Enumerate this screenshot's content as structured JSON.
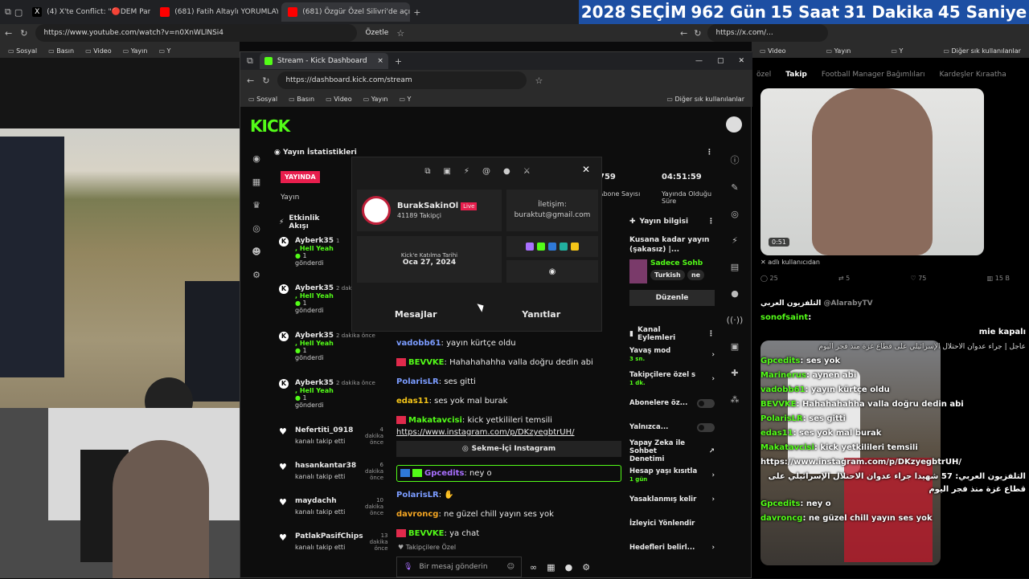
{
  "browser_left": {
    "tabs": [
      {
        "label": "(4) X'te Conflict: \"🔴DEM Partisi\""
      },
      {
        "label": "(681) Fatih Altaylı YORUMLAYAMIYOR"
      },
      {
        "label": "(681) Özgür Özel Silivri'de açıkla"
      }
    ],
    "url": "https://www.youtube.com/watch?v=n0XnWLlNSi4",
    "summarize_label": "Özetle",
    "bookmarks": [
      "Sosyal",
      "Basın",
      "Video",
      "Yayın",
      "Y"
    ]
  },
  "banner": {
    "year": "2028",
    "word": "SEÇİM",
    "days": "962 Gün",
    "hours": "15 Saat",
    "minutes": "31 Dakika",
    "seconds": "45 Saniye"
  },
  "browser_right": {
    "url": "https://x.com/...",
    "bookmarks": [
      "Video",
      "Yayın",
      "Y"
    ],
    "other_bookmarks": "Diğer sık kullanılanlar"
  },
  "kick": {
    "window_tab": "Stream - Kick Dashboard",
    "url": "https://dashboard.kick.com/stream",
    "bookmarks": [
      "Sosyal",
      "Basın",
      "Video",
      "Yayın",
      "Y"
    ],
    "other_bookmarks": "Diğer sık kullanılanlar",
    "logo": "KICK",
    "stats_title": "Yayın İstatistikleri",
    "live_badge": "YAYINDA",
    "live_label": "Yayın",
    "stat_subs_value": "759",
    "stat_subs_label": "Abone Sayısı",
    "stat_time_value": "04:51:59",
    "stat_time_label": "Yayında Olduğu Süre",
    "events_title": "Etkinlik Akışı",
    "events": [
      {
        "name": "Ayberk35",
        "time": "1",
        "message": "Hell Yeah",
        "count": "1",
        "action": "gönderdi"
      },
      {
        "name": "Ayberk35",
        "time": "2 dakika önce",
        "message": "Hell Yeah",
        "count": "1",
        "action": "gönderdi"
      },
      {
        "name": "Ayberk35",
        "time": "2 dakika önce",
        "message": "Hell Yeah",
        "count": "1",
        "action": "gönderdi"
      },
      {
        "name": "Ayberk35",
        "time": "2 dakika önce",
        "message": "Hell Yeah",
        "count": "1",
        "action": "gönderdi"
      }
    ],
    "follows": [
      {
        "name": "Nefertiti_0918",
        "time": "4 dakika önce",
        "action": "kanalı takip etti"
      },
      {
        "name": "hasankantar38",
        "time": "6 dakika önce",
        "action": "kanalı takip etti"
      },
      {
        "name": "maydachh",
        "time": "10 dakika önce",
        "action": "kanalı takip etti"
      },
      {
        "name": "PatlakPasifChips",
        "time": "13 dakika önce",
        "action": "kanalı takip etti"
      }
    ],
    "chat": [
      {
        "user": "vadobb61",
        "text": ": yayın kürtçe oldu",
        "color": "#7b9cff"
      },
      {
        "user": "BEVVKE",
        "text": ": Hahahahahha valla doğru dedin abi",
        "color": "#53fc18"
      },
      {
        "user": "PolarisLR",
        "text": ": ses gitti",
        "color": "#7b9cff"
      },
      {
        "user": "edas11",
        "text": ": ses yok mal burak",
        "color": "#f5c518"
      },
      {
        "user": "Makatavcisi",
        "text": ": kick yetkilileri temsili",
        "color": "#53fc18"
      }
    ],
    "chat_link": "https://www.instagram.com/p/DKzyegbtrUH/",
    "chat_link_button": "Sekme-İçi Instagram",
    "chat_highlight": {
      "user": "Gpcedits",
      "text": ": ney o",
      "color": "#a970ff"
    },
    "chat2": [
      {
        "user": "PolarisLR",
        "text": ":",
        "color": "#7b9cff"
      },
      {
        "user": "davroncg",
        "text": ": ne güzel chill yayın ses yok",
        "color": "#f5a623"
      },
      {
        "user": "BEVVKE",
        "text": ": ya chat",
        "color": "#53fc18"
      }
    ],
    "sub_only": "Takipçilere Özel",
    "chat_placeholder": "Bir mesaj gönderin",
    "stream_info_title": "Yayın bilgisi",
    "stream_title": "Kusana kadar yayın (şakasız) |...",
    "category": "Sadece Sohb",
    "tags": [
      "Turkish",
      "ne"
    ],
    "edit_button": "Düzenle",
    "mod_title": "Kanal Eylemleri",
    "mod_actions": [
      {
        "label": "Yavaş mod",
        "sub": "3 sn.",
        "kind": "chevron"
      },
      {
        "label": "Takipçilere özel s",
        "sub": "1 dk.",
        "kind": "chevron"
      },
      {
        "label": "Abonelere öz...",
        "sub": "",
        "kind": "toggle"
      },
      {
        "label": "Yalnızca...",
        "sub": "",
        "kind": "toggle"
      },
      {
        "label": "Yapay Zeka ile Sohbet Denetimi",
        "sub": "",
        "kind": "external"
      },
      {
        "label": "Hesap yaşı kısıtla",
        "sub": "1 gün",
        "kind": "chevron"
      },
      {
        "label": "Yasaklanmış kelir",
        "sub": "",
        "kind": "chevron"
      },
      {
        "label": "İzleyici Yönlendir",
        "sub": "",
        "kind": "none"
      },
      {
        "label": "Hedefleri belirl...",
        "sub": "",
        "kind": "chevron"
      }
    ],
    "profile": {
      "name": "BurakSakinOl",
      "live": "Live",
      "followers": "41189 Takipçi",
      "contact_label": "İletişim:",
      "contact_email": "buraktut@gmail.com",
      "joined_label": "Kick'e Katılma Tarihi",
      "joined_date": "Oca 27, 2024",
      "tab_messages": "Mesajlar",
      "tab_replies": "Yanıtlar"
    }
  },
  "x": {
    "tabs": [
      "özel",
      "Takip",
      "Football Manager Bağımlıları",
      "Kardeşler Kıraatha"
    ],
    "duration": "0:51",
    "username_caption": "adlı kullanıcıdan",
    "stats": [
      "25",
      "5",
      "75",
      "15 B"
    ],
    "tweet_author": "التلفزيون العربي",
    "tweet_handle": "@AlarabyTV",
    "tweet_text": "عاجل | جراء عدوان الاحتلال الإسرائيلي على قطاع غزة منذ فجر اليوم"
  },
  "overlay_chat": [
    {
      "user": "sonofsaint",
      "text": ":"
    },
    {
      "user": "",
      "text": "mie kapalı"
    },
    {
      "user": "Gpcedits",
      "text": ": ses yok"
    },
    {
      "user": "Marinerus",
      "text": ": aynen abi"
    },
    {
      "user": "vadobb61",
      "text": ": yayın kürtçe oldu"
    },
    {
      "user": "BEVVKE",
      "text": ": Hahahahahha valla doğru dedin abi"
    },
    {
      "user": "PolarisLR",
      "text": ": ses gitti"
    },
    {
      "user": "edas11",
      "text": ": ses yok mal burak"
    },
    {
      "user": "Makatavcisi",
      "text": ": kick yetkilileri temsili"
    },
    {
      "user": "",
      "text": "https://www.instagram.com/p/DKzyegbtrUH/"
    },
    {
      "user": "Gpcedits",
      "text": ": ney o"
    },
    {
      "user": "davroncg",
      "text": ": ne güzel chill yayın ses yok"
    }
  ],
  "overlay_arabic": "التلفزيون العربي: 57 شهيدا جراء عدوان الاحتلال الإسرائيلي على قطاع غزة منذ فجر اليوم",
  "colors": {
    "kick_green": "#53fc18",
    "live_red": "#e81e4d",
    "banner_blue": "#1d4fa3"
  }
}
